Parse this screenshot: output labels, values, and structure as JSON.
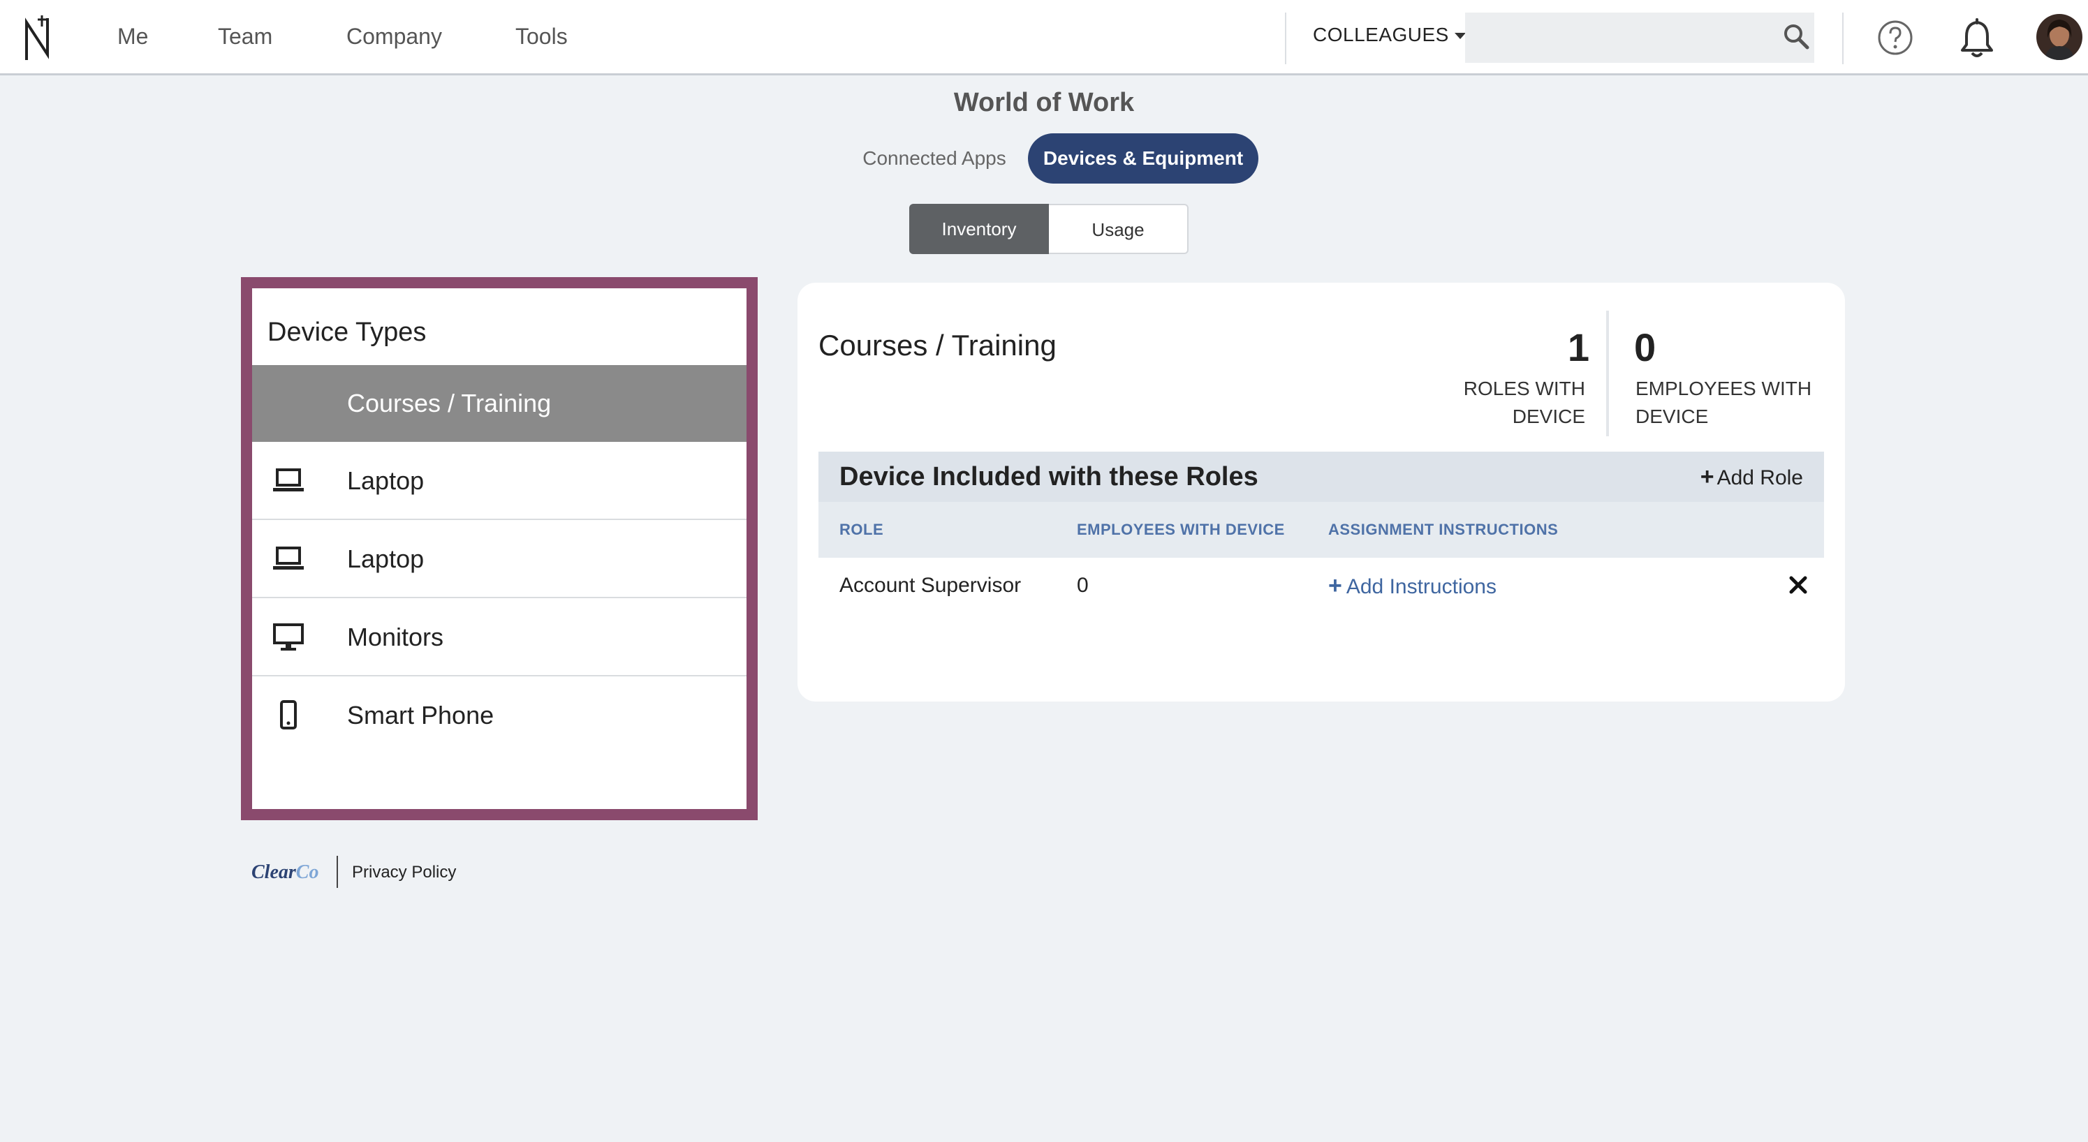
{
  "nav": {
    "logo_name": "N-logo-icon",
    "links": [
      "Me",
      "Team",
      "Company",
      "Tools"
    ],
    "colleagues_label": "COLLEAGUES",
    "search_placeholder": ""
  },
  "header": {
    "title": "World of Work",
    "tabs": [
      {
        "label": "Connected Apps",
        "active": false
      },
      {
        "label": "Devices & Equipment",
        "active": true
      }
    ],
    "segments": [
      {
        "label": "Inventory",
        "active": true
      },
      {
        "label": "Usage",
        "active": false
      }
    ]
  },
  "device_types": {
    "title": "Device Types",
    "items": [
      {
        "label": "Courses / Training",
        "icon": "",
        "active": true
      },
      {
        "label": "Laptop",
        "icon": "laptop-icon",
        "active": false
      },
      {
        "label": "Laptop",
        "icon": "laptop-icon",
        "active": false
      },
      {
        "label": "Monitors",
        "icon": "monitor-icon",
        "active": false
      },
      {
        "label": "Smart Phone",
        "icon": "smartphone-icon",
        "active": false
      }
    ]
  },
  "detail": {
    "title": "Courses / Training",
    "stats": [
      {
        "value": "1",
        "label_line1": "ROLES WITH",
        "label_line2": "DEVICE"
      },
      {
        "value": "0",
        "label_line1": "EMPLOYEES WITH",
        "label_line2": "DEVICE"
      }
    ],
    "roles_section_title": "Device Included with these Roles",
    "add_role_label": "Add Role",
    "columns": [
      "ROLE",
      "EMPLOYEES WITH DEVICE",
      "ASSIGNMENT INSTRUCTIONS"
    ],
    "rows": [
      {
        "role": "Account Supervisor",
        "employees": "0",
        "instructions_link": "Add Instructions"
      }
    ]
  },
  "footer": {
    "brand_part1": "Clear",
    "brand_part2": "Co",
    "privacy_label": "Privacy Policy"
  },
  "colors": {
    "accent": "#2c4373",
    "frame": "#8a4a6d",
    "active_item": "#8a8a8a",
    "link": "#3f66a0"
  }
}
